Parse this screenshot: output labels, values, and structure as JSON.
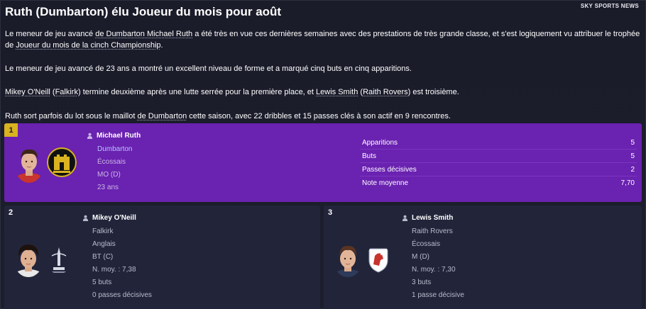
{
  "source": "SKY SPORTS NEWS",
  "headline": "Ruth (Dumbarton) élu Joueur du mois pour août",
  "paragraphs": {
    "p1a": "Le meneur de jeu avancé ",
    "p1_link1": "de Dumbarton Michael Ruth",
    "p1b": " a été très en vue ces dernières semaines avec des prestations de très grande classe, et s'est logiquement vu attribuer le trophée de ",
    "p1_link2": "Joueur du mois de la cinch Championship",
    "p1c": ".",
    "p2": "Le meneur de jeu avancé de 23 ans a montré un excellent niveau de forme et a marqué cinq buts en cinq apparitions.",
    "p3_link1": "Mikey O'Neill",
    "p3a": " (",
    "p3_link2": "Falkirk",
    "p3b": ") termine deuxième après une lutte serrée pour la première place, et ",
    "p3_link3": "Lewis Smith",
    "p3c": " (",
    "p3_link4": "Raith Rovers",
    "p3d": ") est troisième.",
    "p4a": "Ruth sort parfois du lot sous le maillot ",
    "p4_link1": "de Dumbarton",
    "p4b": " cette saison, avec 22 dribbles et 15 passes clés à son actif en 9 rencontres."
  },
  "winner": {
    "rank": "1",
    "name": "Michael Ruth",
    "club": "Dumbarton",
    "nationality": "Écossais",
    "position": "MO (D)",
    "age": "23 ans",
    "stats": [
      {
        "label": "Apparitions",
        "value": "5"
      },
      {
        "label": "Buts",
        "value": "5"
      },
      {
        "label": "Passes décisives",
        "value": "2"
      },
      {
        "label": "Note moyenne",
        "value": "7,70"
      }
    ]
  },
  "second": {
    "rank": "2",
    "name": "Mikey O'Neill",
    "club": "Falkirk",
    "nationality": "Anglais",
    "position": "BT (C)",
    "rating": "N. moy. : 7,38",
    "goals": "5 buts",
    "assists": "0 passes décisives"
  },
  "third": {
    "rank": "3",
    "name": "Lewis Smith",
    "club": "Raith Rovers",
    "nationality": "Écossais",
    "position": "M (D)",
    "rating": "N. moy. : 7,30",
    "goals": "3 buts",
    "assists": "1 passe décisive"
  },
  "colors": {
    "background": "#1b1d2b",
    "winner_card": "#6a22b0",
    "rank_badge": "#d9b320",
    "runner_card": "#22253a"
  }
}
